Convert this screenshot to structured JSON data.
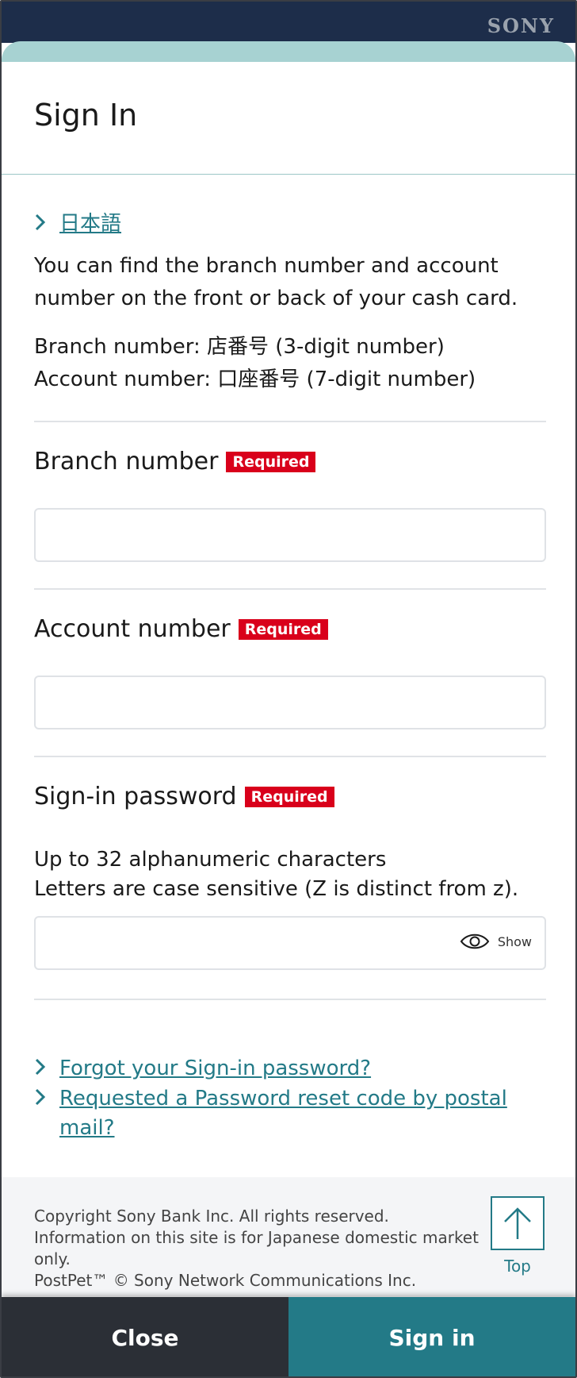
{
  "header": {
    "brand": "SONY",
    "title": "Sign In"
  },
  "language_link": {
    "label": "日本語",
    "icon": "chevron-right-icon"
  },
  "intro": {
    "text": "You can find the branch number and account number on the front or back of your cash card.",
    "branch_hint": "Branch number: 店番号 (3-digit number)",
    "account_hint": "Account number: 口座番号 (7-digit number)"
  },
  "form": {
    "required_badge": "Required",
    "branch": {
      "label": "Branch number",
      "value": "",
      "placeholder": ""
    },
    "account": {
      "label": "Account number",
      "value": "",
      "placeholder": ""
    },
    "password": {
      "label": "Sign-in password",
      "hint_line1": "Up to 32 alphanumeric characters",
      "hint_line2": "Letters are case sensitive (Z is distinct from z).",
      "value": "",
      "placeholder": "",
      "show_label": "Show",
      "show_icon": "eye-icon"
    }
  },
  "links": {
    "forgot": "Forgot your Sign-in password?",
    "postal": "Requested a Password reset code by postal mail?"
  },
  "footer": {
    "copyright": "Copyright Sony Bank Inc. All rights reserved. Information on this site is for Japanese domestic market only.",
    "postpet": "PostPet™ © Sony Network Communications Inc.",
    "top_label": "Top",
    "top_icon": "arrow-up-icon"
  },
  "actions": {
    "close": "Close",
    "sign_in": "Sign in"
  },
  "colors": {
    "header_bg": "#1d2d4a",
    "accent_strip": "#a7d2d2",
    "link": "#237a87",
    "required_bg": "#d9001b",
    "close_bg": "#2b2f36",
    "signin_bg": "#237a87"
  }
}
